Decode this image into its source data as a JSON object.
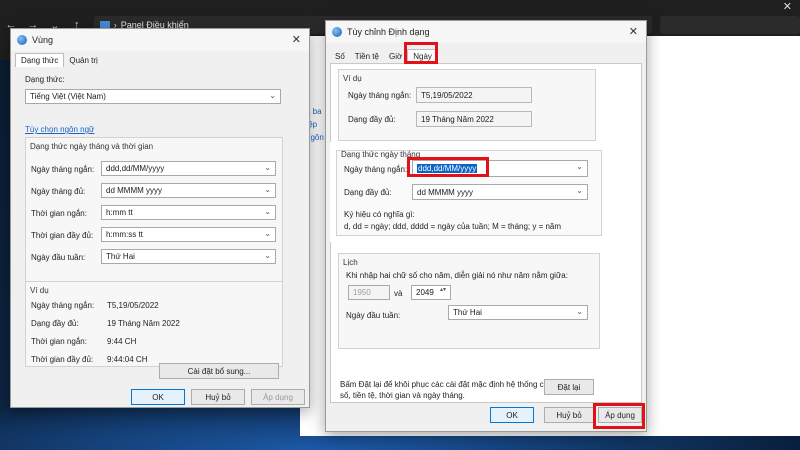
{
  "explorer": {
    "breadcrumb_root": "Panel Điều khiển",
    "close": "✕"
  },
  "cp_links": [
    "a ba",
    "tệp",
    "ngôn"
  ],
  "region_dialog": {
    "title": "Vùng",
    "tabs": [
      "Dạng thức",
      "Quản trị"
    ],
    "format_label": "Dạng thức:",
    "format_value": "Tiếng Việt (Việt Nam)",
    "language_pref_link": "Tùy chọn ngôn ngữ",
    "datetime_group_label": "Dạng thức ngày tháng và thời gian",
    "rows": [
      {
        "label": "Ngày tháng ngắn:",
        "value": "ddd,dd/MM/yyyy"
      },
      {
        "label": "Ngày tháng đủ:",
        "value": "dd MMMM yyyy"
      },
      {
        "label": "Thời gian ngắn:",
        "value": "h:mm tt"
      },
      {
        "label": "Thời gian đầy đủ:",
        "value": "h:mm:ss tt"
      },
      {
        "label": "Ngày đầu tuần:",
        "value": "Thứ Hai"
      }
    ],
    "example_group_label": "Ví dụ",
    "examples": [
      {
        "label": "Ngày tháng ngắn:",
        "value": "T5,19/05/2022"
      },
      {
        "label": "Dạng đầy đủ:",
        "value": "19 Tháng Năm 2022"
      },
      {
        "label": "Thời gian ngắn:",
        "value": "9:44 CH"
      },
      {
        "label": "Thời gian đầy đủ:",
        "value": "9:44:04 CH"
      }
    ],
    "additional_settings": "Cài đặt bổ sung...",
    "ok": "OK",
    "cancel": "Huỷ bỏ",
    "apply": "Áp dụng"
  },
  "custom_dialog": {
    "title": "Tùy chỉnh Định dạng",
    "tabs": [
      "Số",
      "Tiền tệ",
      "Giờ",
      "Ngày"
    ],
    "example_label": "Ví dụ",
    "ex_short_label": "Ngày tháng ngắn:",
    "ex_short_value": "T5,19/05/2022",
    "ex_long_label": "Dạng đầy đủ:",
    "ex_long_value": "19 Tháng Năm 2022",
    "date_format_group": "Dạng thức ngày tháng",
    "short_date_label": "Ngày tháng ngắn:",
    "short_date_value": "ddd,dd/MM/yyyy",
    "long_date_label": "Dạng đầy đủ:",
    "long_date_value": "dd MMMM yyyy",
    "notation_title": "Ký hiệu có nghĩa gì:",
    "notation_text": "d, dd = ngày;  ddd, dddd = ngày của tuần;  M = tháng;  y = năm",
    "calendar_group": "Lịch",
    "two_digit_text": "Khi nhập hai chữ số cho năm, diễn giải nó như năm nằm giữa:",
    "year_from": "1950",
    "and": "và",
    "year_to": "2049",
    "first_day_label": "Ngày đầu tuần:",
    "first_day_value": "Thứ Hai",
    "reset_text": "Bấm Đặt lại để khôi phục các cài đặt mặc định hệ thống cho số, tiền tệ, thời gian và ngày tháng.",
    "reset_button": "Đặt lại",
    "ok": "OK",
    "cancel": "Huỷ bỏ",
    "apply": "Áp dụng"
  }
}
